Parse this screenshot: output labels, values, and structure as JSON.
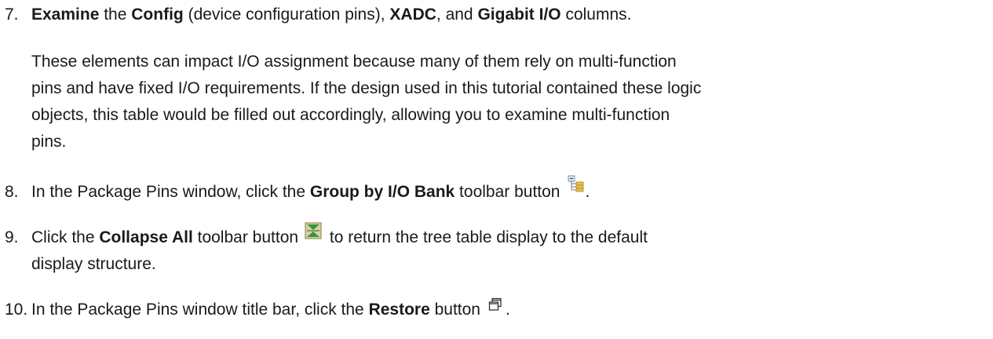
{
  "steps": [
    {
      "number": "7.",
      "parts": [
        "Examine",
        " the ",
        "Config",
        " (device configuration pins), ",
        "XADC",
        ", and ",
        "Gigabit I/O",
        " columns."
      ],
      "paragraph": {
        "line1": "These elements can impact I/O assignment because many of them rely on multi-function",
        "line2": "pins and have fixed I/O requirements. If the design used in this tutorial contained these logic",
        "line3": "objects, this table would be filled out accordingly, allowing you to examine multi-function",
        "line4": "pins."
      }
    },
    {
      "number": "8.",
      "parts": [
        "In the Package Pins window, click the ",
        "Group by I/O Bank",
        " toolbar button",
        "."
      ],
      "icon": "group-by-io-bank-icon"
    },
    {
      "number": "9.",
      "parts": [
        "Click the ",
        "Collapse All",
        " toolbar button",
        " to return the tree table display to the default"
      ],
      "line2": "display structure.",
      "icon": "collapse-all-icon"
    },
    {
      "number": "10.",
      "parts": [
        "In the Package Pins window title bar, click the ",
        "Restore",
        " button",
        "."
      ],
      "icon": "restore-icon"
    }
  ]
}
